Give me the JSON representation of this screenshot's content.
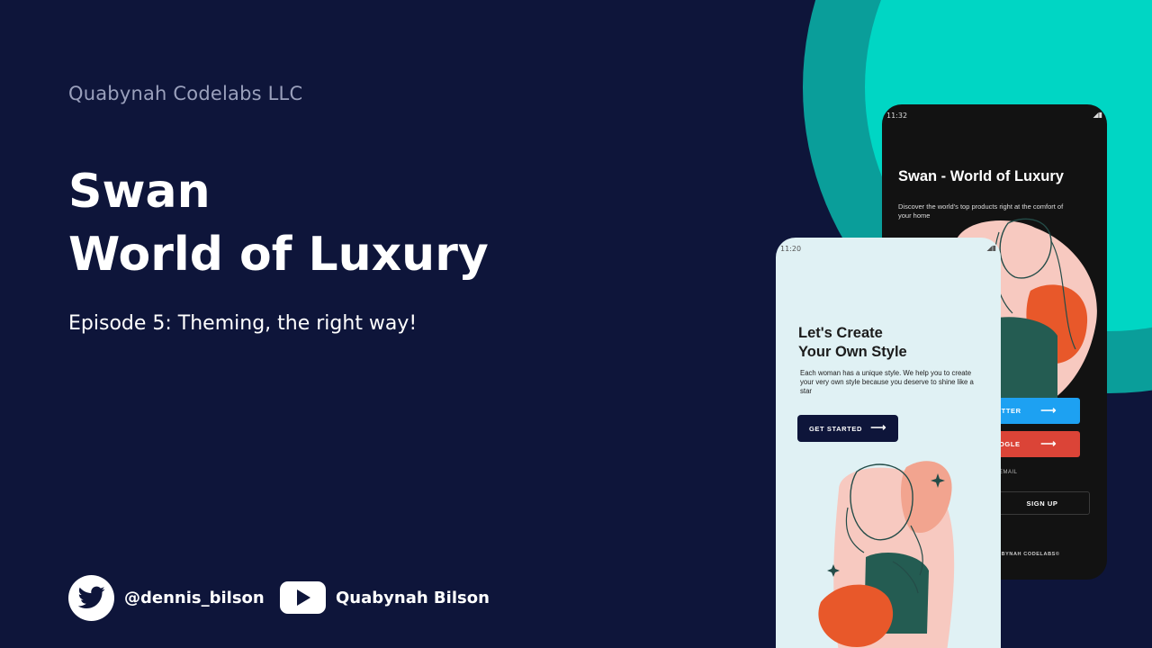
{
  "company": "Quabynah Codelabs LLC",
  "title": {
    "line1": "Swan",
    "line2": "World of Luxury"
  },
  "subtitle": "Episode 5: Theming, the right way!",
  "social": {
    "twitter": {
      "icon": "twitter-icon",
      "handle": "@dennis_bilson"
    },
    "youtube": {
      "icon": "youtube-icon",
      "channel": "Quabynah Bilson"
    }
  },
  "colors": {
    "background": "#0e153a",
    "ring_outer": "#0a9e9a",
    "ring_inner": "#00d6c4",
    "twitter_blue": "#1da1f2",
    "google_red": "#db4437",
    "illustration_orange": "#e8582a",
    "illustration_pink": "#f7c9c0",
    "illustration_green": "#245c52"
  },
  "dark_phone": {
    "time": "11:32",
    "title": "Swan - World of Luxury",
    "description": "Discover the world's top products right at the comfort of your home",
    "twitter_button": "ITTER",
    "google_button": "OGLE",
    "email_label": "EMAIL",
    "signup_button": "SIGN UP",
    "footer": "ABYNAH CODELABS©"
  },
  "light_phone": {
    "time": "11:20",
    "title": {
      "line1": "Let's Create",
      "line2": "Your Own Style"
    },
    "description": "Each woman has a unique style. We help you to create your very own style because you deserve to shine like a star",
    "cta_button": "GET STARTED"
  }
}
